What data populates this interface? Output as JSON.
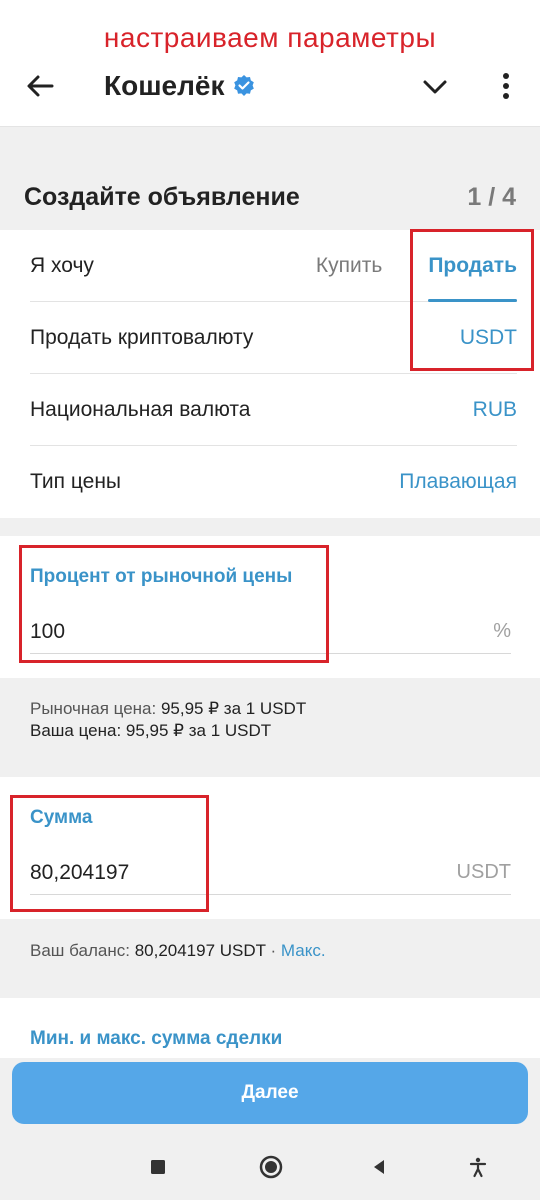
{
  "annotation": {
    "caption": "настраиваем параметры"
  },
  "appbar": {
    "title": "Кошелёк",
    "icons": [
      "arrow-left-icon",
      "verified-icon",
      "chevron-down-icon",
      "kebab-menu-icon"
    ]
  },
  "section": {
    "title": "Создайте объявление",
    "step": "1 / 4"
  },
  "form": {
    "want": {
      "label": "Я хочу",
      "buy": "Купить",
      "sell": "Продать",
      "selected": "Продать"
    },
    "crypto": {
      "label": "Продать криптовалюту",
      "value": "USDT"
    },
    "fiat": {
      "label": "Национальная валюта",
      "value": "RUB"
    },
    "price_type": {
      "label": "Тип цены",
      "value": "Плавающая"
    },
    "percent": {
      "label": "Процент от рыночной цены",
      "value": "100",
      "suffix": "%"
    },
    "market_price": {
      "label": "Рыночная цена:",
      "value": "95,95 ₽ за 1 USDT"
    },
    "your_price": {
      "label": "Ваша цена:",
      "value": "95,95 ₽ за 1 USDT"
    },
    "amount": {
      "label": "Сумма",
      "value": "80,204197",
      "suffix": "USDT"
    },
    "balance": {
      "label": "Ваш баланс:",
      "value": "80,204197 USDT",
      "separator": "·",
      "max_link": "Макс."
    },
    "limits": {
      "label": "Мин. и макс. сумма сделки"
    }
  },
  "next_button": {
    "label": "Далее"
  },
  "nav": {
    "icons": [
      "square-recent-icon",
      "home-circle-icon",
      "back-triangle-icon",
      "accessibility-icon"
    ]
  },
  "colors": {
    "accent": "#3a93c8",
    "button": "#55a7e8",
    "annotation": "#d8232a"
  }
}
